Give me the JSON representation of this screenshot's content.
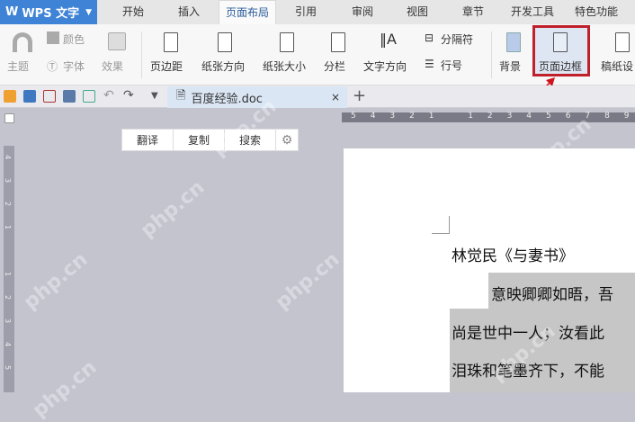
{
  "app": {
    "name": "WPS 文字"
  },
  "tabs": [
    "开始",
    "插入",
    "页面布局",
    "引用",
    "审阅",
    "视图",
    "章节",
    "开发工具",
    "特色功能"
  ],
  "active_tab": "页面布局",
  "ribbon": {
    "theme": "主题",
    "color": "颜色",
    "font": "字体",
    "effect": "效果",
    "margins": "页边距",
    "orientation": "纸张方向",
    "size": "纸张大小",
    "columns": "分栏",
    "text_direction": "文字方向",
    "breaks": "分隔符",
    "line_numbers": "行号",
    "background": "背景",
    "page_border": "页面边框",
    "manuscript": "稿纸设"
  },
  "document_tab": {
    "name": "百度经验.doc",
    "close": "×",
    "new": "+"
  },
  "ruler": {
    "h_labels": [
      "5",
      "4",
      "3",
      "2",
      "1",
      "",
      "1",
      "2",
      "3",
      "4",
      "5",
      "6",
      "7",
      "8",
      "9"
    ],
    "v_labels": [
      "4",
      "3",
      "2",
      "1",
      "",
      "1",
      "2",
      "3",
      "4",
      "5"
    ]
  },
  "float_toolbar": {
    "translate": "翻译",
    "copy": "复制",
    "search": "搜索"
  },
  "document": {
    "lines": [
      "林觉民《与妻书》",
      "意映卿卿如晤，吾",
      "尚是世中一人；汝看此",
      "泪珠和笔墨齐下，不能"
    ]
  },
  "watermark": "php.cn",
  "colors": {
    "accent": "#3e83d6",
    "highlight": "#c0202a"
  }
}
